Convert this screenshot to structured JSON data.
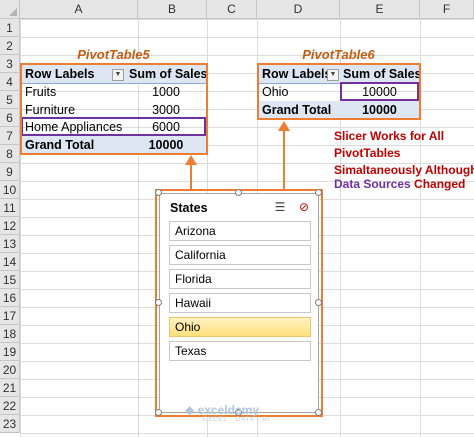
{
  "columns": [
    "A",
    "B",
    "C",
    "D",
    "E",
    "F"
  ],
  "rows": [
    "1",
    "2",
    "3",
    "4",
    "5",
    "6",
    "7",
    "8",
    "9",
    "10",
    "11",
    "12",
    "13",
    "14",
    "15",
    "16",
    "17",
    "18",
    "19",
    "20",
    "21",
    "22",
    "23"
  ],
  "pivot1": {
    "title": "PivotTable5",
    "row_labels_header": "Row Labels",
    "sum_header": "Sum of Sales",
    "rows": [
      {
        "label": "Fruits",
        "value": "1000"
      },
      {
        "label": "Furniture",
        "value": "3000"
      },
      {
        "label": "Home Appliances",
        "value": "6000"
      }
    ],
    "grand_total_label": "Grand Total",
    "grand_total_value": "10000"
  },
  "pivot2": {
    "title": "PivotTable6",
    "row_labels_header": "Row Labels",
    "sum_header": "Sum of Sales",
    "rows": [
      {
        "label": "Ohio",
        "value": "10000"
      }
    ],
    "grand_total_label": "Grand Total",
    "grand_total_value": "10000"
  },
  "note": {
    "line1": "Slicer Works for All",
    "line2": "PivotTables",
    "line3": "Simaltaneously Although",
    "line4_part1": "Data Sources",
    "line4_part2": "Changed"
  },
  "slicer": {
    "title": "States",
    "items": [
      "Arizona",
      "California",
      "Florida",
      "Hawaii",
      "Ohio",
      "Texas"
    ],
    "selected": "Ohio",
    "multi_select_icon": "multi-select-icon",
    "clear_filter_icon": "clear-filter-icon"
  },
  "watermark": {
    "brand": "exceldemy",
    "tagline": "EXCEL · DATA · BI"
  },
  "colors": {
    "orange": "#ed7d31",
    "purple": "#7030a0",
    "red": "#c00000",
    "title_orange": "#c55a11",
    "header_blue": "#dde6f2",
    "selected_item": "#ffe07a"
  }
}
